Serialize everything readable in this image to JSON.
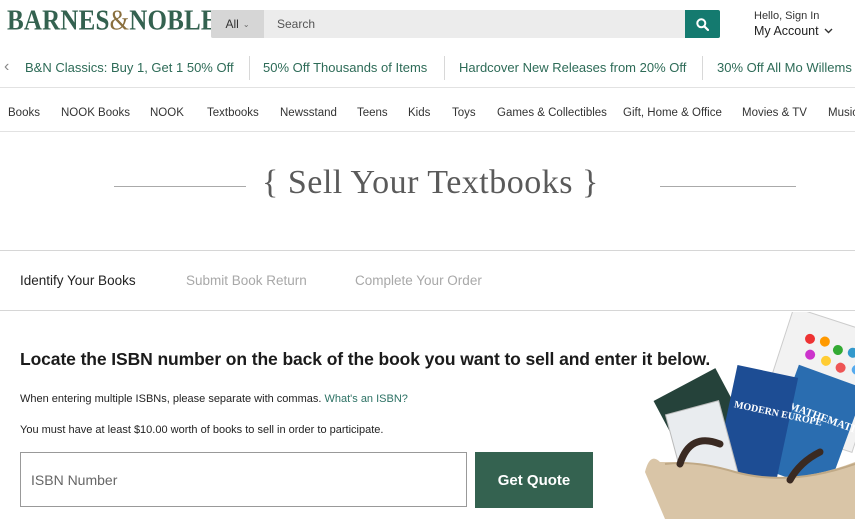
{
  "header": {
    "logo_main": "BARNES",
    "logo_amp": "&",
    "logo_end": "NOBLE",
    "search": {
      "category": "All",
      "placeholder": "Search"
    },
    "account": {
      "greeting": "Hello, Sign In",
      "label": "My Account"
    }
  },
  "promos": [
    "B&N Classics: Buy 1, Get 1 50% Off",
    "50% Off Thousands of Items",
    "Hardcover New Releases from 20% Off",
    "30% Off All Mo Willems"
  ],
  "categories": [
    "Books",
    "NOOK Books",
    "NOOK",
    "Textbooks",
    "Newsstand",
    "Teens",
    "Kids",
    "Toys",
    "Games & Collectibles",
    "Gift, Home & Office",
    "Movies & TV",
    "Music"
  ],
  "page": {
    "title": "{ Sell Your Textbooks }"
  },
  "steps": [
    "Identify Your Books",
    "Submit Book Return",
    "Complete Your Order"
  ],
  "form": {
    "headline": "Locate the ISBN number on the back of the book you want to sell and enter it below.",
    "note_multiple": "When entering multiple ISBNs, please separate with commas.",
    "isbn_link": "What's an ISBN?",
    "note_minimum": "You must have at least $10.00 worth of books to sell in order to participate.",
    "isbn_placeholder": "ISBN Number",
    "submit_label": "Get Quote"
  },
  "image": {
    "book_title_1": "MODERN EUROPE",
    "book_title_2": "MATHEMATICS"
  },
  "colors": {
    "brand_green": "#346250",
    "search_teal": "#147a6f",
    "link_green": "#2d6b57"
  }
}
